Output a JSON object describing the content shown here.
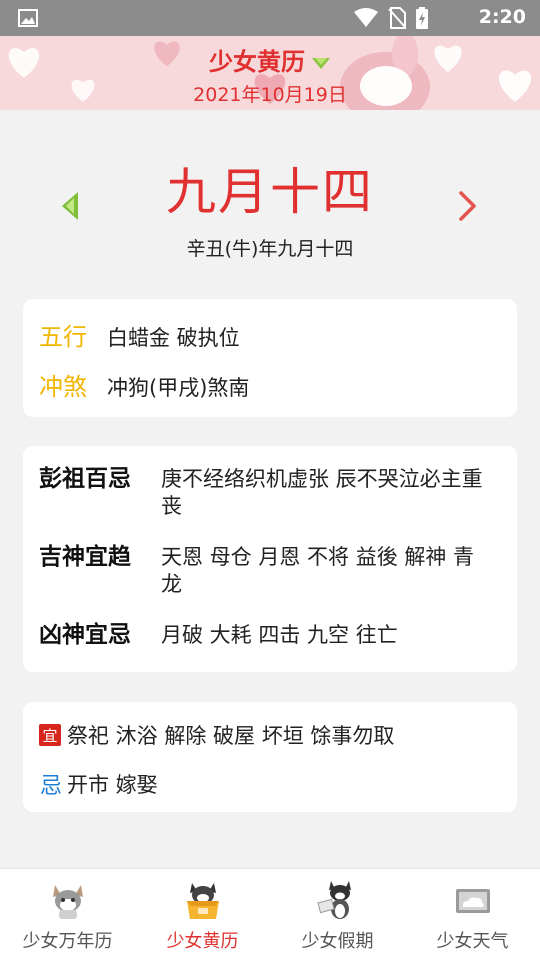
{
  "status_bar": {
    "time": "2:20",
    "icons": [
      "photo-icon",
      "wifi-icon",
      "no-sim-icon",
      "battery-icon"
    ]
  },
  "header": {
    "title": "少女黄历",
    "date": "2021年10月19日",
    "accent_color": "#e0302f",
    "background_color": "#f7d9dc"
  },
  "lunar": {
    "day_big": "九月十四",
    "ganzhi": "辛丑(牛)年九月十四"
  },
  "card_basic": {
    "wuxing_label": "五行",
    "wuxing_value": "白蜡金 破执位",
    "chongsha_label": "冲煞",
    "chongsha_value": "冲狗(甲戌)煞南"
  },
  "card_details": {
    "pengzu_label": "彭祖百忌",
    "pengzu_value": "庚不经络织机虚张 辰不哭泣必主重丧",
    "jishen_label": "吉神宜趋",
    "jishen_value": "天恩 母仓 月恩 不将 益後 解神 青龙",
    "xiongshen_label": "凶神宜忌",
    "xiongshen_value": "月破 大耗 四击 九空 往亡"
  },
  "card_yiji": {
    "yi_badge": "宜",
    "yi_value": "祭祀 沐浴 解除 破屋 坏垣 馀事勿取",
    "ji_badge": "忌",
    "ji_value": "开市 嫁娶"
  },
  "tabs": [
    {
      "label": "少女万年历",
      "icon": "corgi-icon",
      "active": false
    },
    {
      "label": "少女黄历",
      "icon": "cat-box-icon",
      "active": true
    },
    {
      "label": "少女假期",
      "icon": "cat-sign-icon",
      "active": false
    },
    {
      "label": "少女天气",
      "icon": "cloud-icon",
      "active": false
    }
  ]
}
